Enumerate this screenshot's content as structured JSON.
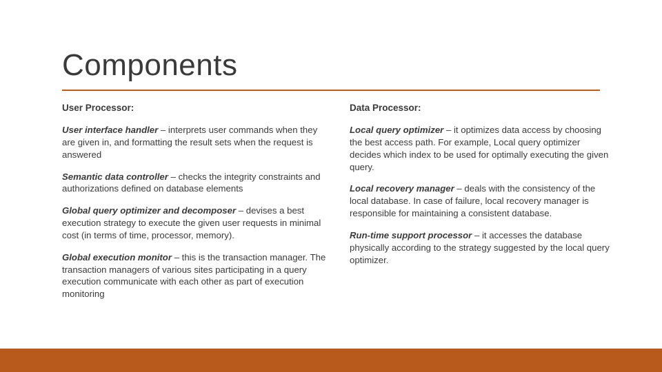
{
  "title": "Components",
  "left": {
    "heading": "User Processor:",
    "items": [
      {
        "term": "User interface handler",
        "desc": " – interprets user commands when they are given in, and formatting the result sets when the request is answered"
      },
      {
        "term": "Semantic data controller",
        "desc": " – checks the integrity constraints and authorizations defined on database elements"
      },
      {
        "term": "Global query optimizer and decomposer",
        "desc": " – devises a best execution strategy to execute the given user requests in minimal cost (in terms of time, processor, memory)."
      },
      {
        "term": "Global execution monitor",
        "desc": " – this is the transaction manager. The transaction managers of various sites participating in a query execution communicate with each other as part of execution monitoring"
      }
    ]
  },
  "right": {
    "heading": "Data Processor:",
    "items": [
      {
        "term": "Local query optimizer",
        "desc": " – it optimizes data access by choosing the best access path. For example, Local query optimizer decides which index to be used for optimally executing the given query."
      },
      {
        "term": "Local recovery manager",
        "desc": " – deals with the consistency of the local database. In case of failure, local recovery manager is responsible for maintaining a consistent database."
      },
      {
        "term": "Run-time support processor",
        "desc": " – it accesses the database physically according to the strategy suggested by the local query optimizer."
      }
    ]
  }
}
